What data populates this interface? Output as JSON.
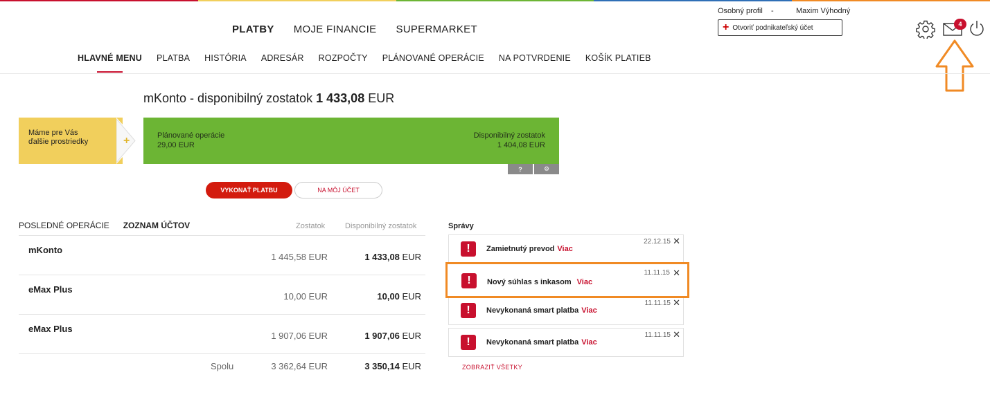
{
  "colors": {
    "brand_red": "#c8102e",
    "promo_yellow": "#f1cf5c",
    "balance_green": "#6cb534",
    "annotation_orange": "#f08a24"
  },
  "top_colors": [
    "#c8102e",
    "#f1cf5c",
    "#6cb534",
    "#2f6fb6",
    "#f08a24"
  ],
  "main_nav": [
    {
      "label": "PLATBY",
      "active": true
    },
    {
      "label": "MOJE FINANCIE",
      "active": false
    },
    {
      "label": "SUPERMARKET",
      "active": false
    }
  ],
  "profile": {
    "label": "Osobný profil    -",
    "name": "Maxim Výhodný",
    "business_button": "Otvoriť podnikateľský účet"
  },
  "header_icons": {
    "settings": "gear-icon",
    "messages": "envelope-icon",
    "logout": "power-icon",
    "unread_count": "4"
  },
  "sub_nav": [
    {
      "label": "HLAVNÉ MENU",
      "active": true
    },
    {
      "label": "PLATBA",
      "active": false
    },
    {
      "label": "HISTÓRIA",
      "active": false
    },
    {
      "label": "ADRESÁR",
      "active": false
    },
    {
      "label": "ROZPOČTY",
      "active": false
    },
    {
      "label": "PLÁNOVANÉ OPERÁCIE",
      "active": false
    },
    {
      "label": "NA POTVRDENIE",
      "active": false
    },
    {
      "label": "KOŠÍK PLATIEB",
      "active": false
    }
  ],
  "account_summary": {
    "title_prefix": "mKonto - disponibilný zostatok",
    "amount": "1 433,08",
    "currency": "EUR"
  },
  "promo": {
    "text": "Máme pre Vás ďalšie prostriedky",
    "plus": "+"
  },
  "balance_bar": {
    "planned_label": "Plánované operácie",
    "planned_value": "29,00 EUR",
    "available_label": "Disponibilný zostatok",
    "available_value": "1 404,08 EUR",
    "help_label": "?",
    "settings_label": "⚙"
  },
  "actions": {
    "execute_payment": "VYKONAŤ PLATBU",
    "to_my_account": "NA MÔJ ÚČET"
  },
  "accounts_panel": {
    "tabs": [
      {
        "label": "POSLEDNÉ OPERÁCIE",
        "active": false
      },
      {
        "label": "ZOZNAM ÚČTOV",
        "active": true
      }
    ],
    "col_balance": "Zostatok",
    "col_available": "Disponibilný zostatok",
    "rows": [
      {
        "name": "mKonto",
        "balance": "1 445,58 EUR",
        "available_amount": "1 433,08",
        "currency": "EUR"
      },
      {
        "name": "eMax Plus",
        "balance": "10,00 EUR",
        "available_amount": "10,00",
        "currency": "EUR"
      },
      {
        "name": "eMax Plus",
        "balance": "1 907,06 EUR",
        "available_amount": "1 907,06",
        "currency": "EUR"
      }
    ],
    "total": {
      "label": "Spolu",
      "balance": "3 362,64 EUR",
      "available_amount": "3 350,14",
      "currency": "EUR"
    }
  },
  "messages": {
    "title": "Správy",
    "items": [
      {
        "text": "Zamietnutý prevod",
        "more": "Viac",
        "date": "22.12.15"
      },
      {
        "text": "Nový súhlas s inkasom",
        "more": "Viac",
        "date": "11.11.15"
      },
      {
        "text": "Nevykonaná smart platba",
        "more": "Viac",
        "date": "11.11.15"
      },
      {
        "text": "Nevykonaná smart platba",
        "more": "Viac",
        "date": "11.11.15"
      }
    ],
    "show_all": "ZOBRAZIŤ VŠETKY"
  }
}
